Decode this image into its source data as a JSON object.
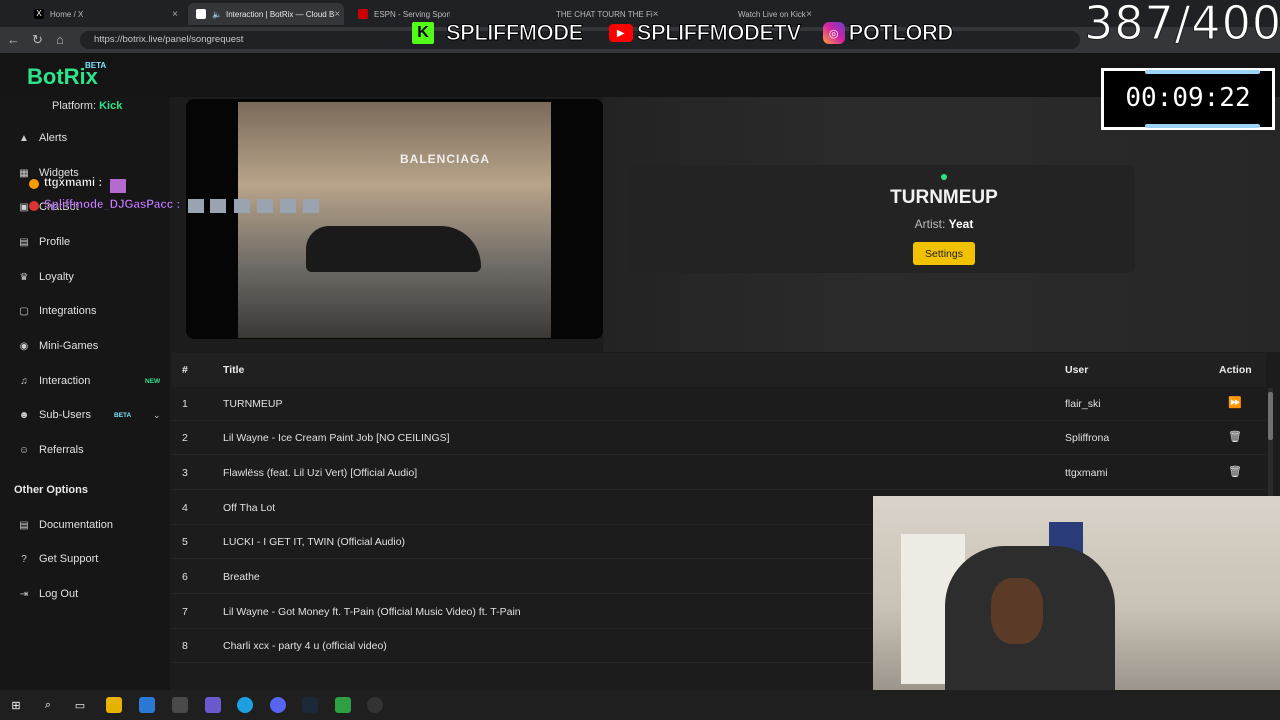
{
  "browser": {
    "tabs": [
      {
        "label": "Home / X",
        "active": false
      },
      {
        "label": "Interaction | BotRix — Cloud B",
        "active": true
      },
      {
        "label": "ESPN - Serving Sports",
        "active": false
      },
      {
        "label": "THE CHAT TOURN THE Fi",
        "active": false
      },
      {
        "label": "Watch Live on Kick",
        "active": false
      }
    ],
    "url": "https://botrix.live/panel/songrequest"
  },
  "site": {
    "logo": "BotRix",
    "logo_badge": "BETA",
    "platform_label": "Platform:",
    "platform_value": "Kick"
  },
  "sidebar": {
    "items": [
      {
        "label": "Alerts",
        "icon": "warning-icon"
      },
      {
        "label": "Widgets",
        "icon": "grid-icon"
      },
      {
        "label": "ChatBot",
        "icon": "robot-icon"
      },
      {
        "label": "Profile",
        "icon": "id-card-icon"
      },
      {
        "label": "Loyalty",
        "icon": "trophy-icon"
      },
      {
        "label": "Integrations",
        "icon": "plug-icon"
      },
      {
        "label": "Mini-Games",
        "icon": "gamepad-icon"
      },
      {
        "label": "Interaction",
        "icon": "music-icon",
        "badge": "NEW"
      },
      {
        "label": "Sub-Users",
        "icon": "users-icon",
        "badge": "BETA"
      },
      {
        "label": "Referrals",
        "icon": "people-icon"
      }
    ],
    "other_heading": "Other Options",
    "other_items": [
      {
        "label": "Documentation",
        "icon": "book-icon"
      },
      {
        "label": "Get Support",
        "icon": "question-icon"
      },
      {
        "label": "Log Out",
        "icon": "logout-icon"
      }
    ]
  },
  "now_playing": {
    "title": "TURNMEUP",
    "artist_label": "Artist:",
    "artist": "Yeat",
    "settings_label": "Settings",
    "video_sign": "BALENCIAGA"
  },
  "queue": {
    "headers": {
      "num": "#",
      "title": "Title",
      "user": "User",
      "action": "Action"
    },
    "rows": [
      {
        "num": "1",
        "title": "TURNMEUP",
        "user": "flair_ski",
        "action": "skip-icon"
      },
      {
        "num": "2",
        "title": "Lil Wayne - Ice Cream Paint Job [NO CEILINGS]",
        "user": "Spliffrona",
        "action": "trash-icon"
      },
      {
        "num": "3",
        "title": "Flawlëss (feat. Lil Uzi Vert) [Official Audio]",
        "user": "ttgxmami",
        "action": "trash-icon"
      },
      {
        "num": "4",
        "title": "Off Tha Lot",
        "user": "",
        "action": ""
      },
      {
        "num": "5",
        "title": "LUCKI - I GET IT, TWIN (Official Audio)",
        "user": "",
        "action": ""
      },
      {
        "num": "6",
        "title": "Breathe",
        "user": "",
        "action": ""
      },
      {
        "num": "7",
        "title": "Lil Wayne - Got Money ft. T-Pain (Official Music Video) ft. T-Pain",
        "user": "",
        "action": ""
      },
      {
        "num": "8",
        "title": "Charli xcx - party 4 u (official video)",
        "user": "",
        "action": ""
      }
    ]
  },
  "overlay": {
    "kick_handle": "SPLIFFMODE",
    "youtube_handle": "SPLIFFMODETV",
    "instagram_handle": "POTLORD",
    "counter": "387/400",
    "timer": "00:09:22",
    "chat": [
      {
        "user": "ttgxmami",
        "sep": ":"
      },
      {
        "user": "Spliffmode_DJGasPacc",
        "sep": ":"
      }
    ]
  },
  "colors": {
    "brand": "#2ee28a",
    "settings_button": "#f2c200",
    "beta": "#7be3ff"
  }
}
